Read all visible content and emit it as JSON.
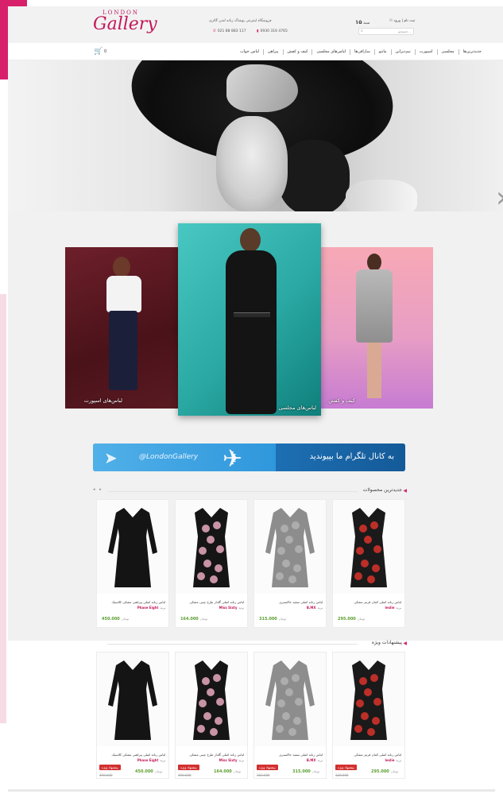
{
  "header": {
    "logo_top": "LONDON",
    "logo_main": "Gallery",
    "tagline": "فروشگاه اینترنتی پوشاک زنانه لندن گالری",
    "phone_1": "021 88 883 117",
    "phone_2": "0930 316 4765",
    "login_label": "ثبت نام | ورود",
    "cart_count": "۱۵",
    "cart_label": "سبد",
    "search_placeholder": "جستجو..."
  },
  "nav": {
    "items": [
      "جدیدترین‌ها",
      "مجلسی",
      "اسپورت",
      "تیم‌دیزاین",
      "مانتو",
      "سارافن‌ها",
      "لباس‌های مجلسی",
      "کیف و کفش",
      "پیراهن",
      "لباس خواب"
    ],
    "basket_count": "0"
  },
  "categories": [
    {
      "label": "لباس‌های اسپورت"
    },
    {
      "label": "لباس‌های مجلسی"
    },
    {
      "label": "کیف و کفش"
    }
  ],
  "telegram": {
    "handle": "@LondonGallery",
    "text": "به کانال تلگرام ما بپیوندید"
  },
  "newest": {
    "title": "جدیدترین محصولات",
    "products": [
      {
        "name": "لباس زنانه اصلی کمان قرمز مشکی",
        "brand_prefix": "برند",
        "brand": "leslie",
        "price": "295.000",
        "unit": "تومان",
        "dress": "red-floral"
      },
      {
        "name": "لباس زنانه اصلی سفید خاکستری",
        "brand_prefix": "برند",
        "brand": "B.MX",
        "price": "315.000",
        "unit": "تومان",
        "dress": "grey-knit"
      },
      {
        "name": "لباس زنانه اصلی گلدار طرح چینی مشکی",
        "brand_prefix": "برند",
        "brand": "Miss Sixty",
        "price": "164.000",
        "unit": "تومان",
        "dress": "black-floral"
      },
      {
        "name": "لباس زنانه اصلی پیراهنی مشکی کلاسیک",
        "brand_prefix": "برند",
        "brand": "Phase Eight",
        "price": "450.000",
        "unit": "تومان",
        "dress": "black-plain"
      }
    ]
  },
  "special": {
    "title": "پیشنهادات ویژه",
    "badge": "پیشنهاد ویژه",
    "products": [
      {
        "name": "لباس زنانه اصلی کمان قرمز مشکی",
        "brand_prefix": "برند",
        "brand": "leslie",
        "price": "295.000",
        "old_price": "320.000",
        "unit": "تومان",
        "dress": "red-floral"
      },
      {
        "name": "لباس زنانه اصلی سفید خاکستری",
        "brand_prefix": "برند",
        "brand": "B.MX",
        "price": "315.000",
        "old_price": "350.000",
        "unit": "تومان",
        "dress": "grey-knit"
      },
      {
        "name": "لباس زنانه اصلی گلدار طرح چینی مشکی",
        "brand_prefix": "برند",
        "brand": "Miss Sixty",
        "price": "164.000",
        "old_price": "190.000",
        "unit": "تومان",
        "dress": "black-floral"
      },
      {
        "name": "لباس زنانه اصلی پیراهنی مشکی کلاسیک",
        "brand_prefix": "برند",
        "brand": "Phase Eight",
        "price": "450.000",
        "old_price": "490.000",
        "unit": "تومان",
        "dress": "black-plain"
      }
    ]
  },
  "colors": {
    "brand": "#c2185b",
    "accent": "#d8206a",
    "price": "#5a9e2f",
    "telegram": "#2f97dc"
  }
}
